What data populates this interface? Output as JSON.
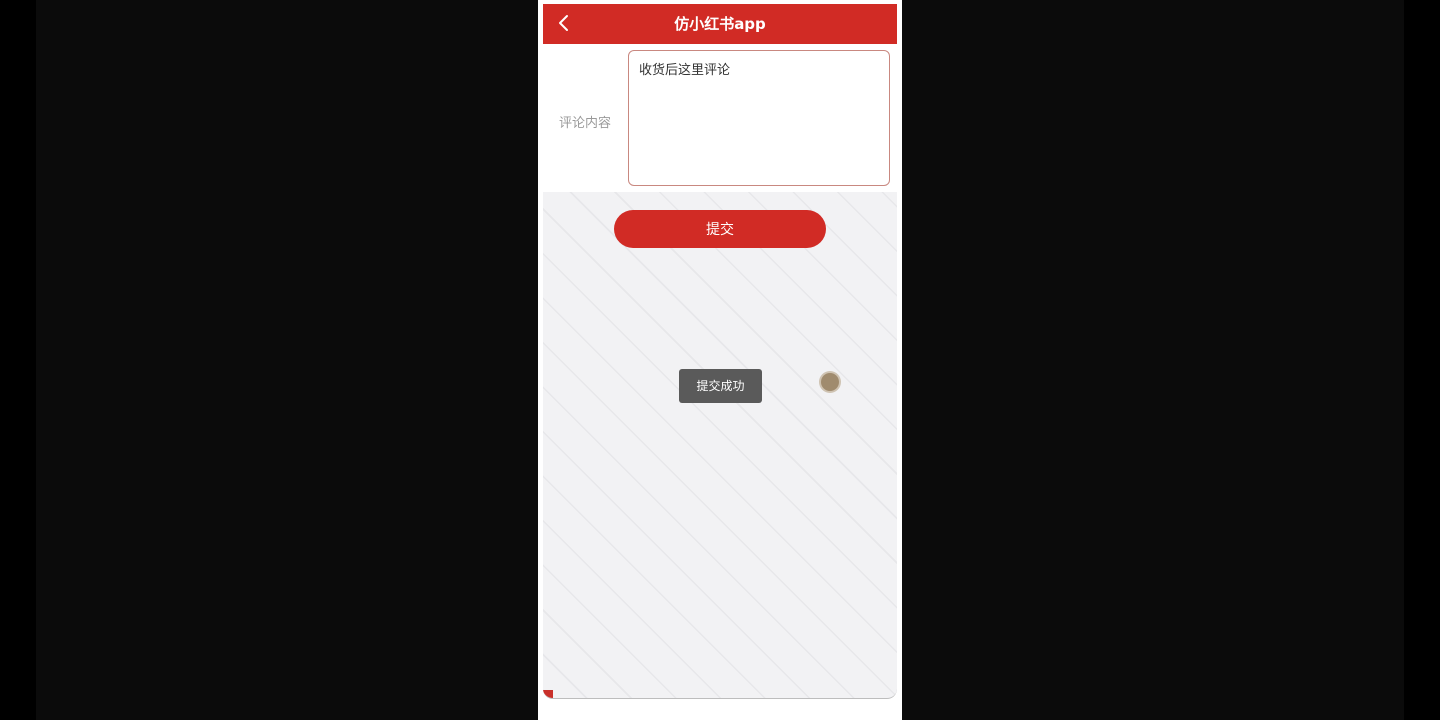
{
  "header": {
    "title": "仿小红书app",
    "back_icon": "chevron-left-icon",
    "background_color": "#d12b25"
  },
  "form": {
    "comment_label": "评论内容",
    "comment_value": "收货后这里评论"
  },
  "actions": {
    "submit_label": "提交",
    "button_color": "#d12b25"
  },
  "toast": {
    "message": "提交成功"
  },
  "touch_indicator": {
    "icon": "touch-point-icon"
  }
}
